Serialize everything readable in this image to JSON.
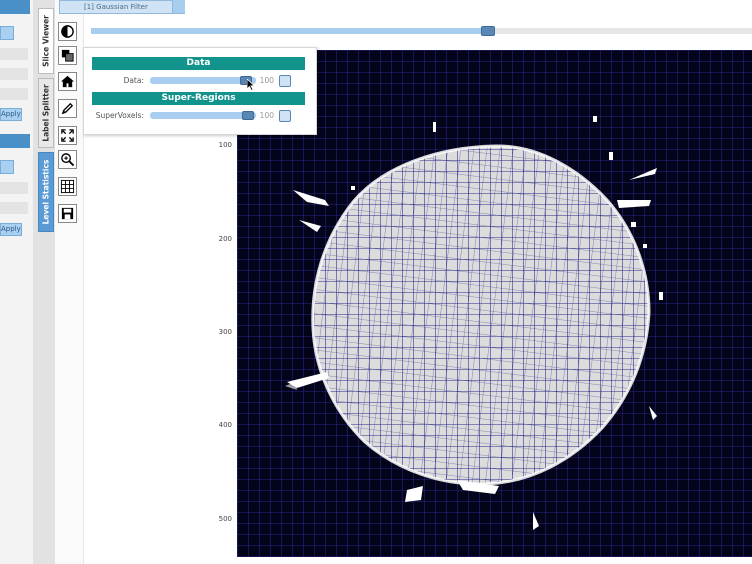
{
  "header": {
    "filter_tab_label": "[1] Gaussian Filter"
  },
  "side_tabs": [
    "Slice Viewer",
    "Label Splitter",
    "Level Statistics"
  ],
  "left_panel": {
    "apply_label": "Apply"
  },
  "tools": [
    "contrast-icon",
    "layers-icon",
    "home-icon",
    "pencil-icon",
    "fit-view-icon",
    "zoom-icon",
    "grid-icon",
    "save-icon"
  ],
  "popup": {
    "data_section": {
      "title": "Data",
      "label": "Data:",
      "value": "100"
    },
    "regions_section": {
      "title": "Super-Regions",
      "label": "SuperVoxels:",
      "value": "100"
    }
  },
  "slice_slider": {
    "fraction": 0.6
  },
  "viewer": {
    "y_ticks": [
      "100",
      "200",
      "300",
      "400",
      "500"
    ]
  },
  "colors": {
    "accent_teal": "#12948d",
    "slider_blue": "#a9cdee",
    "supervoxel_edge": "#2c2c8a"
  }
}
